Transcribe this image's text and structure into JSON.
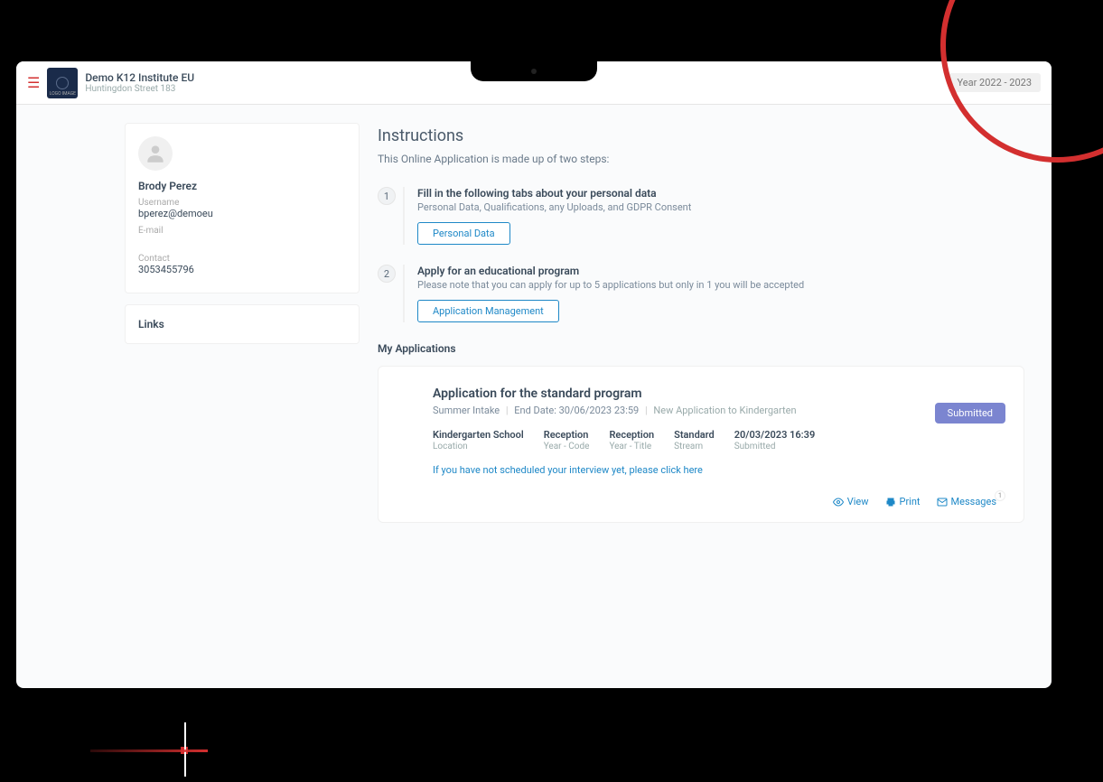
{
  "header": {
    "institution_name": "Demo K12 Institute EU",
    "address": "Huntingdon Street 183",
    "year_range": "Year 2022 - 2023"
  },
  "profile": {
    "name": "Brody Perez",
    "username_label": "Username",
    "username": "bperez@demoeu",
    "email_label": "E-mail",
    "email": "",
    "contact_label": "Contact",
    "contact": "3053455796"
  },
  "links": {
    "title": "Links"
  },
  "instructions": {
    "title": "Instructions",
    "subtitle": "This Online Application is made up of two steps:",
    "steps": [
      {
        "num": "1",
        "title": "Fill in the following tabs about your personal data",
        "desc": "Personal Data, Qualifications, any Uploads, and GDPR Consent",
        "button": "Personal Data"
      },
      {
        "num": "2",
        "title": "Apply for an educational program",
        "desc": "Please note that you can apply for up to 5 applications but only in 1 you will be accepted",
        "button": "Application Management"
      }
    ]
  },
  "my_applications": {
    "title": "My Applications",
    "items": [
      {
        "title": "Application for the standard program",
        "intake": "Summer Intake",
        "end_date_label": "End Date: 30/06/2023 23:59",
        "new_app_text": "New Application to Kindergarten",
        "status": "Submitted",
        "columns": [
          {
            "value": "Kindergarten School",
            "label": "Location"
          },
          {
            "value": "Reception",
            "label": "Year - Code"
          },
          {
            "value": "Reception",
            "label": "Year - Title"
          },
          {
            "value": "Standard",
            "label": "Stream"
          },
          {
            "value": "20/03/2023 16:39",
            "label": "Submitted"
          }
        ],
        "interview_link": "If you have not scheduled your interview yet, please click here",
        "actions": {
          "view": "View",
          "print": "Print",
          "messages": "Messages",
          "msg_count": "1"
        }
      }
    ]
  }
}
